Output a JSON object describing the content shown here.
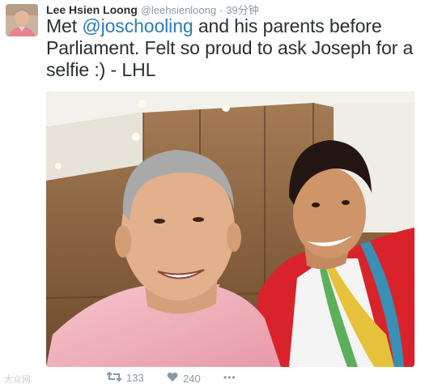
{
  "tweet": {
    "author_name": "Lee Hsien Loong",
    "author_handle": "@leehsienloong",
    "separator": "·",
    "timestamp": "39分钟",
    "text_before": "Met ",
    "mention": "@joschooling",
    "text_after": " and his parents before Parliament. Felt so proud to ask Joseph for a selfie :) - LHL"
  },
  "actions": {
    "retweet_count": "133",
    "like_count": "240",
    "more_label": "•••"
  },
  "watermark": "大众网",
  "colors": {
    "text": "#292f33",
    "muted": "#8899a6",
    "link": "#2b7bb9",
    "jacket": "#d8232a"
  },
  "icons": [
    "retweet-icon",
    "heart-icon",
    "more-icon"
  ]
}
